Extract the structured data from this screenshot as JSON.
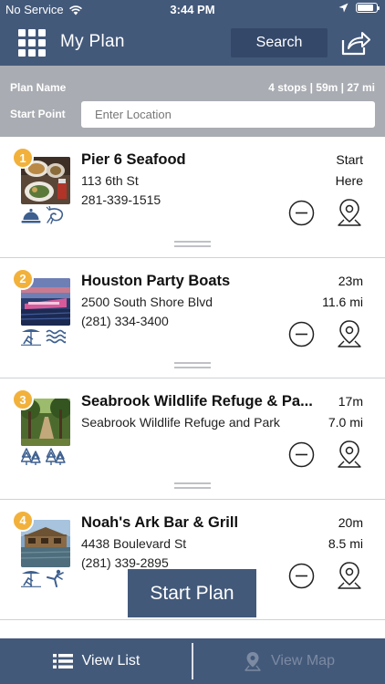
{
  "status_bar": {
    "carrier": "No Service",
    "time": "3:44 PM",
    "battery_level_percent": 85
  },
  "header": {
    "title": "My Plan",
    "search_label": "Search",
    "menu_icon": "grid-menu-icon",
    "share_icon": "share-export-icon"
  },
  "plan": {
    "name_label": "Plan Name",
    "stats": "4 stops | 59m | 27 mi",
    "start_point_label": "Start Point",
    "location_placeholder": "Enter Location"
  },
  "stops": [
    {
      "number": "1",
      "name": "Pier 6 Seafood",
      "address": "113 6th St",
      "phone": "281-339-1515",
      "time": "Start",
      "distance": "Here",
      "categories": [
        "dining-cloche-icon",
        "shrimp-icon"
      ]
    },
    {
      "number": "2",
      "name": "Houston Party Boats",
      "address": "2500 South Shore Blvd",
      "phone": "(281) 334-3400",
      "time": "23m",
      "distance": "11.6 mi",
      "categories": [
        "beach-chair-icon",
        "waves-icon"
      ]
    },
    {
      "number": "3",
      "name": "Seabrook Wildlife Refuge & Pa...",
      "address": "Seabrook Wildlife Refuge and Park",
      "phone": "",
      "time": "17m",
      "distance": "7.0 mi",
      "categories": [
        "trees-icon",
        "trees-icon"
      ]
    },
    {
      "number": "4",
      "name": "Noah's Ark Bar & Grill",
      "address": "4438 Boulevard St",
      "phone": "(281) 339-2895",
      "time": "20m",
      "distance": "8.5 mi",
      "categories": [
        "beach-chair-icon",
        "martial-arts-icon"
      ]
    }
  ],
  "start_plan_label": "Start Plan",
  "tabs": {
    "list_label": "View List",
    "map_label": "View Map"
  },
  "colors": {
    "primary": "#43597a",
    "header_gray": "#a9acb2",
    "badge": "#f2b13a",
    "icon_blue": "#3d5f8f"
  }
}
